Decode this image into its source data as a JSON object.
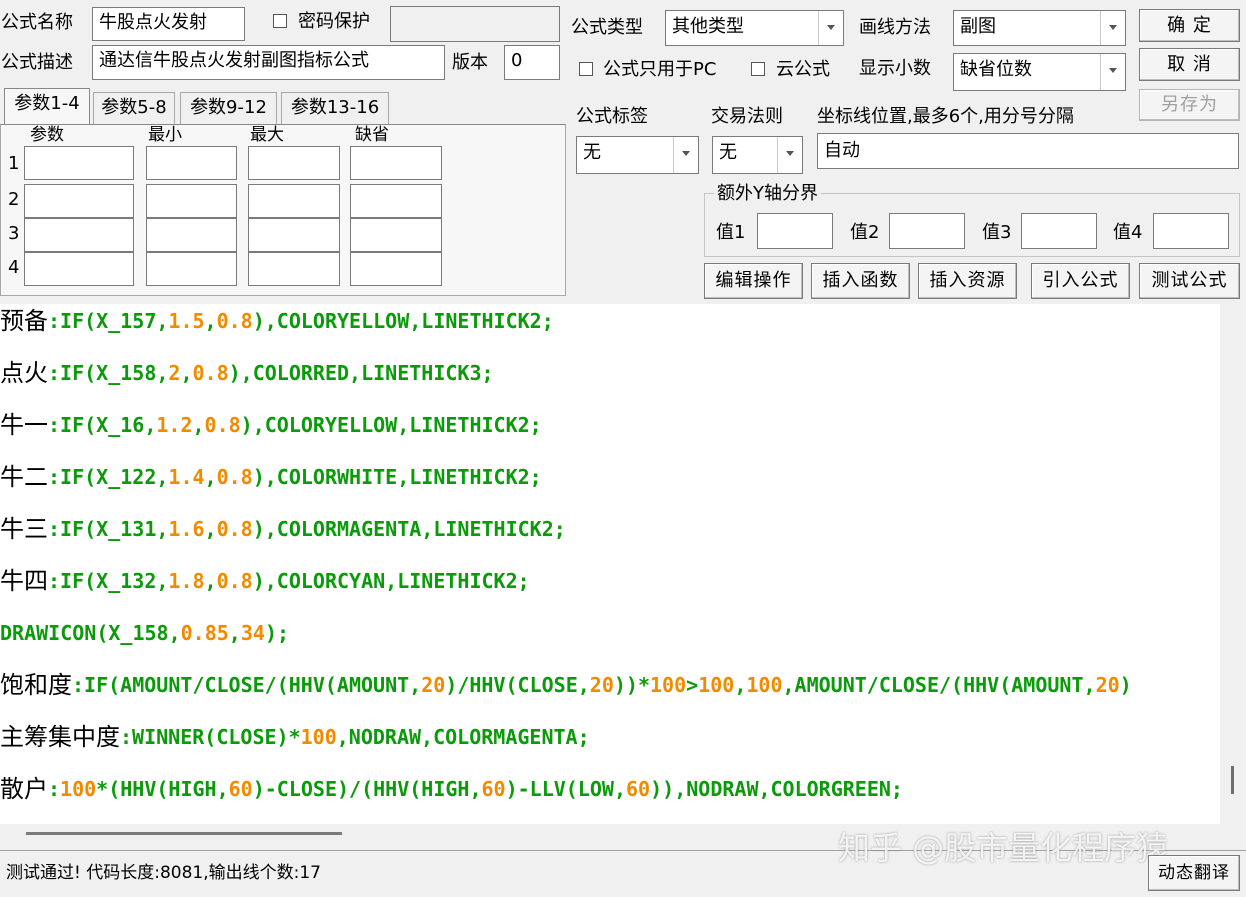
{
  "form": {
    "name_label": "公式名称",
    "name_value": "牛股点火发射",
    "password_label": "密码保护",
    "desc_label": "公式描述",
    "desc_value": "通达信牛股点火发射副图指标公式",
    "version_label": "版本",
    "version_value": "0",
    "type_label": "公式类型",
    "type_value": "其他类型",
    "draw_label": "画线方法",
    "draw_value": "副图",
    "pc_only_label": "公式只用于PC",
    "cloud_label": "云公式",
    "decimals_label": "显示小数",
    "decimals_value": "缺省位数",
    "tag_label": "公式标签",
    "tag_value": "无",
    "rule_label": "交易法则",
    "rule_value": "无",
    "axis_label": "坐标线位置,最多6个,用分号分隔",
    "axis_value": "自动",
    "extra_y_label": "额外Y轴分界",
    "v1_label": "值1",
    "v2_label": "值2",
    "v3_label": "值3",
    "v4_label": "值4"
  },
  "buttons": {
    "ok": "确 定",
    "cancel": "取 消",
    "save_as": "另存为",
    "edit": "编辑操作",
    "insert_func": "插入函数",
    "insert_res": "插入资源",
    "import": "引入公式",
    "test": "测试公式",
    "translate": "动态翻译"
  },
  "tabs": [
    "参数1-4",
    "参数5-8",
    "参数9-12",
    "参数13-16"
  ],
  "param_headers": [
    "参数",
    "最小",
    "最大",
    "缺省"
  ],
  "param_rows": [
    "1",
    "2",
    "3",
    "4"
  ],
  "code_lines": [
    {
      "name": "预备",
      "tokens": [
        [
          ":",
          "g"
        ],
        [
          "IF(X_157,",
          "g"
        ],
        [
          "1.5",
          "o"
        ],
        [
          ",",
          "g"
        ],
        [
          "0.8",
          "o"
        ],
        [
          "),COLORYELLOW,LINETHICK2;",
          "g"
        ]
      ]
    },
    {
      "name": "点火",
      "tokens": [
        [
          ":",
          "g"
        ],
        [
          "IF(X_158,",
          "g"
        ],
        [
          "2",
          "o"
        ],
        [
          ",",
          "g"
        ],
        [
          "0.8",
          "o"
        ],
        [
          "),COLORRED,LINETHICK3;",
          "g"
        ]
      ]
    },
    {
      "name": "牛一",
      "tokens": [
        [
          ":",
          "g"
        ],
        [
          "IF(X_16,",
          "g"
        ],
        [
          "1.2",
          "o"
        ],
        [
          ",",
          "g"
        ],
        [
          "0.8",
          "o"
        ],
        [
          "),COLORYELLOW,LINETHICK2;",
          "g"
        ]
      ]
    },
    {
      "name": "牛二",
      "tokens": [
        [
          ":",
          "g"
        ],
        [
          "IF(X_122,",
          "g"
        ],
        [
          "1.4",
          "o"
        ],
        [
          ",",
          "g"
        ],
        [
          "0.8",
          "o"
        ],
        [
          "),COLORWHITE,LINETHICK2;",
          "g"
        ]
      ]
    },
    {
      "name": "牛三",
      "tokens": [
        [
          ":",
          "g"
        ],
        [
          "IF(X_131,",
          "g"
        ],
        [
          "1.6",
          "o"
        ],
        [
          ",",
          "g"
        ],
        [
          "0.8",
          "o"
        ],
        [
          "),COLORMAGENTA,LINETHICK2;",
          "g"
        ]
      ]
    },
    {
      "name": "牛四",
      "tokens": [
        [
          ":",
          "g"
        ],
        [
          "IF(X_132,",
          "g"
        ],
        [
          "1.8",
          "o"
        ],
        [
          ",",
          "g"
        ],
        [
          "0.8",
          "o"
        ],
        [
          "),COLORCYAN,LINETHICK2;",
          "g"
        ]
      ]
    },
    {
      "name": "",
      "tokens": [
        [
          "DRAWICON(X_158,",
          "g"
        ],
        [
          "0.85",
          "o"
        ],
        [
          ",",
          "g"
        ],
        [
          "34",
          "o"
        ],
        [
          ");",
          "g"
        ]
      ]
    },
    {
      "name": "饱和度",
      "tokens": [
        [
          ":",
          "g"
        ],
        [
          "IF(AMOUNT/CLOSE/(HHV(AMOUNT,",
          "g"
        ],
        [
          "20",
          "o"
        ],
        [
          ")/HHV(CLOSE,",
          "g"
        ],
        [
          "20",
          "o"
        ],
        [
          "))*",
          "g"
        ],
        [
          "100",
          "o"
        ],
        [
          ">",
          "g"
        ],
        [
          "100",
          "o"
        ],
        [
          ",",
          "g"
        ],
        [
          "100",
          "o"
        ],
        [
          ",AMOUNT/CLOSE/(HHV(AMOUNT,",
          "g"
        ],
        [
          "20",
          "o"
        ],
        [
          ")",
          "g"
        ]
      ]
    },
    {
      "name": "主筹集中度",
      "tokens": [
        [
          ":",
          "g"
        ],
        [
          "WINNER(CLOSE)*",
          "g"
        ],
        [
          "100",
          "o"
        ],
        [
          ",NODRAW,COLORMAGENTA;",
          "g"
        ]
      ]
    },
    {
      "name": "散户",
      "tokens": [
        [
          ":",
          "g"
        ],
        [
          "100",
          "o"
        ],
        [
          "*(HHV(HIGH,",
          "g"
        ],
        [
          "60",
          "o"
        ],
        [
          ")-CLOSE)/(HHV(HIGH,",
          "g"
        ],
        [
          "60",
          "o"
        ],
        [
          ")-LLV(LOW,",
          "g"
        ],
        [
          "60",
          "o"
        ],
        [
          ")),NODRAW,COLORGREEN;",
          "g"
        ]
      ]
    }
  ],
  "status_text": "测试通过! 代码长度:8081,输出线个数:17",
  "watermark": "知乎 @股市量化程序猿"
}
